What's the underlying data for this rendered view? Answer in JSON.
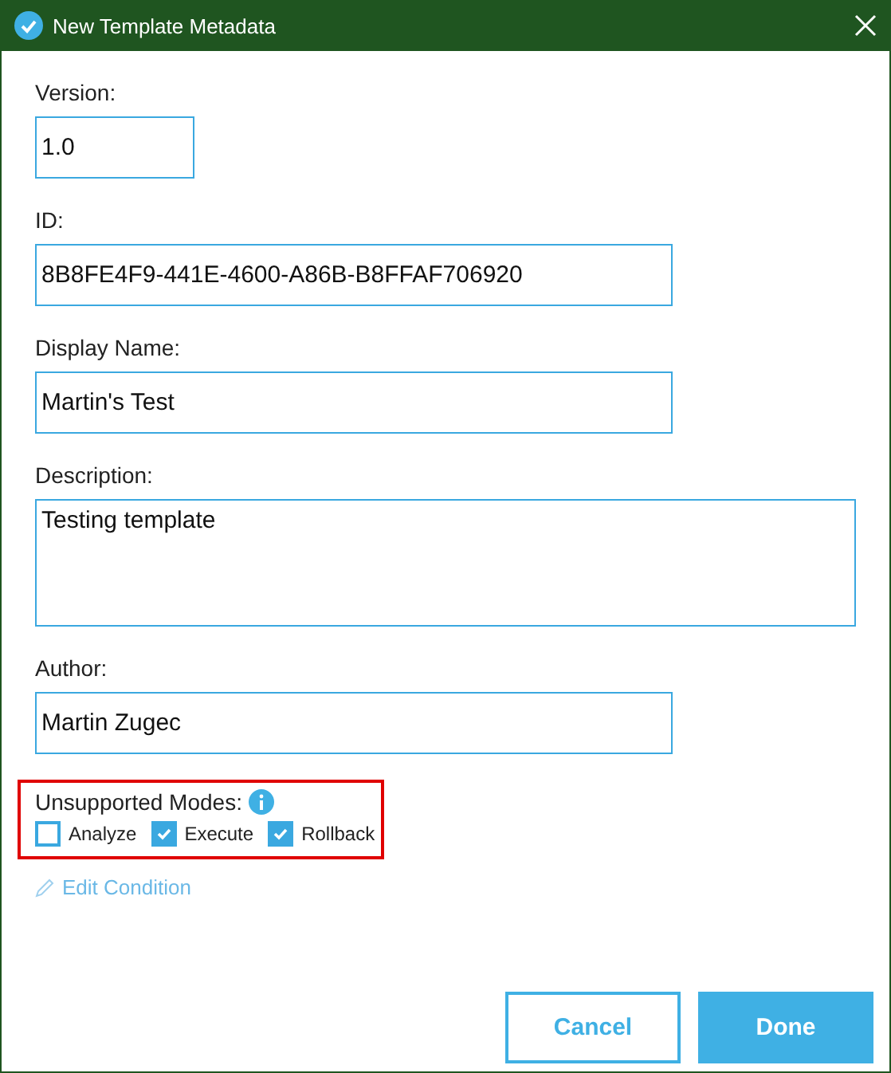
{
  "window": {
    "title": "New Template Metadata"
  },
  "fields": [
    {
      "label": "Version:",
      "value": "1.0",
      "kind": "short"
    },
    {
      "label": "ID:",
      "value": "8B8FE4F9-441E-4600-A86B-B8FFAF706920",
      "kind": "text"
    },
    {
      "label": "Display Name:",
      "value": "Martin's Test",
      "kind": "text"
    },
    {
      "label": "Description:",
      "value": "Testing template",
      "kind": "multiline"
    },
    {
      "label": "Author:",
      "value": "Martin Zugec",
      "kind": "text"
    }
  ],
  "unsupported_modes": {
    "label": "Unsupported Modes:",
    "options": [
      {
        "label": "Analyze",
        "checked": false
      },
      {
        "label": "Execute",
        "checked": true
      },
      {
        "label": "Rollback",
        "checked": true
      }
    ]
  },
  "edit_condition": "Edit Condition",
  "buttons": [
    {
      "label": "Cancel",
      "kind": "secondary"
    },
    {
      "label": "Done",
      "kind": "primary"
    }
  ]
}
